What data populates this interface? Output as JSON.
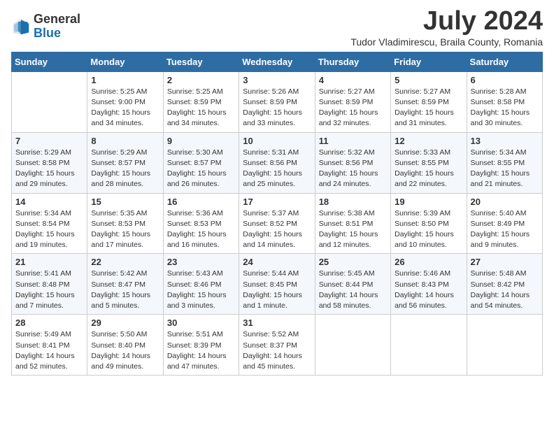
{
  "logo": {
    "general": "General",
    "blue": "Blue"
  },
  "title": "July 2024",
  "location": "Tudor Vladimirescu, Braila County, Romania",
  "headers": [
    "Sunday",
    "Monday",
    "Tuesday",
    "Wednesday",
    "Thursday",
    "Friday",
    "Saturday"
  ],
  "weeks": [
    [
      {
        "day": "",
        "info": ""
      },
      {
        "day": "1",
        "info": "Sunrise: 5:25 AM\nSunset: 9:00 PM\nDaylight: 15 hours\nand 34 minutes."
      },
      {
        "day": "2",
        "info": "Sunrise: 5:25 AM\nSunset: 8:59 PM\nDaylight: 15 hours\nand 34 minutes."
      },
      {
        "day": "3",
        "info": "Sunrise: 5:26 AM\nSunset: 8:59 PM\nDaylight: 15 hours\nand 33 minutes."
      },
      {
        "day": "4",
        "info": "Sunrise: 5:27 AM\nSunset: 8:59 PM\nDaylight: 15 hours\nand 32 minutes."
      },
      {
        "day": "5",
        "info": "Sunrise: 5:27 AM\nSunset: 8:59 PM\nDaylight: 15 hours\nand 31 minutes."
      },
      {
        "day": "6",
        "info": "Sunrise: 5:28 AM\nSunset: 8:58 PM\nDaylight: 15 hours\nand 30 minutes."
      }
    ],
    [
      {
        "day": "7",
        "info": "Sunrise: 5:29 AM\nSunset: 8:58 PM\nDaylight: 15 hours\nand 29 minutes."
      },
      {
        "day": "8",
        "info": "Sunrise: 5:29 AM\nSunset: 8:57 PM\nDaylight: 15 hours\nand 28 minutes."
      },
      {
        "day": "9",
        "info": "Sunrise: 5:30 AM\nSunset: 8:57 PM\nDaylight: 15 hours\nand 26 minutes."
      },
      {
        "day": "10",
        "info": "Sunrise: 5:31 AM\nSunset: 8:56 PM\nDaylight: 15 hours\nand 25 minutes."
      },
      {
        "day": "11",
        "info": "Sunrise: 5:32 AM\nSunset: 8:56 PM\nDaylight: 15 hours\nand 24 minutes."
      },
      {
        "day": "12",
        "info": "Sunrise: 5:33 AM\nSunset: 8:55 PM\nDaylight: 15 hours\nand 22 minutes."
      },
      {
        "day": "13",
        "info": "Sunrise: 5:34 AM\nSunset: 8:55 PM\nDaylight: 15 hours\nand 21 minutes."
      }
    ],
    [
      {
        "day": "14",
        "info": "Sunrise: 5:34 AM\nSunset: 8:54 PM\nDaylight: 15 hours\nand 19 minutes."
      },
      {
        "day": "15",
        "info": "Sunrise: 5:35 AM\nSunset: 8:53 PM\nDaylight: 15 hours\nand 17 minutes."
      },
      {
        "day": "16",
        "info": "Sunrise: 5:36 AM\nSunset: 8:53 PM\nDaylight: 15 hours\nand 16 minutes."
      },
      {
        "day": "17",
        "info": "Sunrise: 5:37 AM\nSunset: 8:52 PM\nDaylight: 15 hours\nand 14 minutes."
      },
      {
        "day": "18",
        "info": "Sunrise: 5:38 AM\nSunset: 8:51 PM\nDaylight: 15 hours\nand 12 minutes."
      },
      {
        "day": "19",
        "info": "Sunrise: 5:39 AM\nSunset: 8:50 PM\nDaylight: 15 hours\nand 10 minutes."
      },
      {
        "day": "20",
        "info": "Sunrise: 5:40 AM\nSunset: 8:49 PM\nDaylight: 15 hours\nand 9 minutes."
      }
    ],
    [
      {
        "day": "21",
        "info": "Sunrise: 5:41 AM\nSunset: 8:48 PM\nDaylight: 15 hours\nand 7 minutes."
      },
      {
        "day": "22",
        "info": "Sunrise: 5:42 AM\nSunset: 8:47 PM\nDaylight: 15 hours\nand 5 minutes."
      },
      {
        "day": "23",
        "info": "Sunrise: 5:43 AM\nSunset: 8:46 PM\nDaylight: 15 hours\nand 3 minutes."
      },
      {
        "day": "24",
        "info": "Sunrise: 5:44 AM\nSunset: 8:45 PM\nDaylight: 15 hours\nand 1 minute."
      },
      {
        "day": "25",
        "info": "Sunrise: 5:45 AM\nSunset: 8:44 PM\nDaylight: 14 hours\nand 58 minutes."
      },
      {
        "day": "26",
        "info": "Sunrise: 5:46 AM\nSunset: 8:43 PM\nDaylight: 14 hours\nand 56 minutes."
      },
      {
        "day": "27",
        "info": "Sunrise: 5:48 AM\nSunset: 8:42 PM\nDaylight: 14 hours\nand 54 minutes."
      }
    ],
    [
      {
        "day": "28",
        "info": "Sunrise: 5:49 AM\nSunset: 8:41 PM\nDaylight: 14 hours\nand 52 minutes."
      },
      {
        "day": "29",
        "info": "Sunrise: 5:50 AM\nSunset: 8:40 PM\nDaylight: 14 hours\nand 49 minutes."
      },
      {
        "day": "30",
        "info": "Sunrise: 5:51 AM\nSunset: 8:39 PM\nDaylight: 14 hours\nand 47 minutes."
      },
      {
        "day": "31",
        "info": "Sunrise: 5:52 AM\nSunset: 8:37 PM\nDaylight: 14 hours\nand 45 minutes."
      },
      {
        "day": "",
        "info": ""
      },
      {
        "day": "",
        "info": ""
      },
      {
        "day": "",
        "info": ""
      }
    ]
  ]
}
